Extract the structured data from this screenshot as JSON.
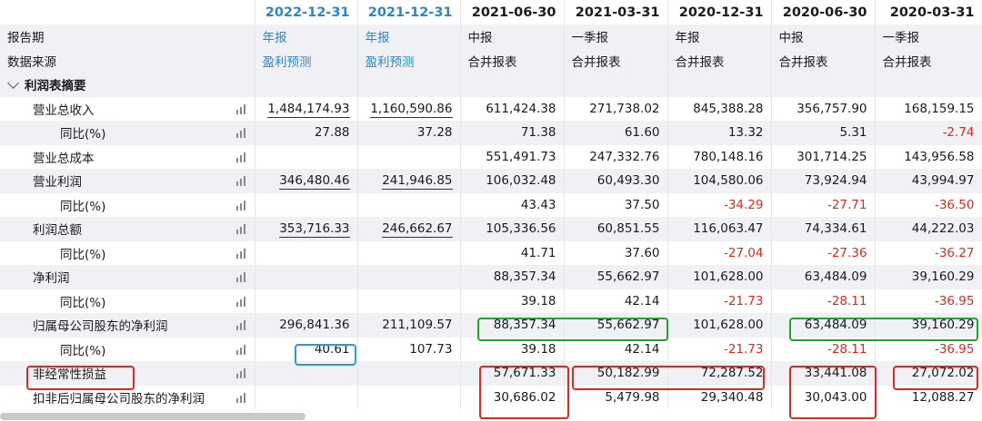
{
  "header": {
    "periods": [
      "2022-12-31",
      "2021-12-31",
      "2021-06-30",
      "2021-03-31",
      "2020-12-31",
      "2020-06-30",
      "2020-03-31"
    ],
    "report_label": "报告期",
    "report_types": [
      "年报",
      "年报",
      "中报",
      "一季报",
      "年报",
      "中报",
      "一季报"
    ],
    "source_label": "数据来源",
    "sources": [
      "盈利预测",
      "盈利预测",
      "合并报表",
      "合并报表",
      "合并报表",
      "合并报表",
      "合并报表"
    ]
  },
  "section": {
    "title": "利润表摘要"
  },
  "rows": [
    {
      "label": "营业总收入",
      "indent": 1,
      "values": [
        "1,484,174.93",
        "1,160,590.86",
        "611,424.38",
        "271,738.02",
        "845,388.28",
        "356,757.90",
        "168,159.15"
      ]
    },
    {
      "label": "同比(%)",
      "indent": 2,
      "values": [
        "27.88",
        "37.28",
        "71.38",
        "61.60",
        "13.32",
        "5.31",
        "-2.74"
      ]
    },
    {
      "label": "营业总成本",
      "indent": 1,
      "values": [
        "",
        "",
        "551,491.73",
        "247,332.76",
        "780,148.16",
        "301,714.25",
        "143,956.58"
      ]
    },
    {
      "label": "营业利润",
      "indent": 1,
      "values": [
        "346,480.46",
        "241,946.85",
        "106,032.48",
        "60,493.30",
        "104,580.06",
        "73,924.94",
        "43,994.97"
      ]
    },
    {
      "label": "同比(%)",
      "indent": 2,
      "values": [
        "",
        "",
        "43.43",
        "37.50",
        "-34.29",
        "-27.71",
        "-36.50"
      ]
    },
    {
      "label": "利润总额",
      "indent": 1,
      "values": [
        "353,716.33",
        "246,662.67",
        "105,336.56",
        "60,851.55",
        "116,063.47",
        "74,334.61",
        "44,222.03"
      ]
    },
    {
      "label": "同比(%)",
      "indent": 2,
      "values": [
        "",
        "",
        "41.71",
        "37.60",
        "-27.04",
        "-27.36",
        "-36.27"
      ]
    },
    {
      "label": "净利润",
      "indent": 1,
      "values": [
        "",
        "",
        "88,357.34",
        "55,662.97",
        "101,628.00",
        "63,484.09",
        "39,160.29"
      ]
    },
    {
      "label": "同比(%)",
      "indent": 2,
      "values": [
        "",
        "",
        "39.18",
        "42.14",
        "-21.73",
        "-28.11",
        "-36.95"
      ]
    },
    {
      "label": "归属母公司股东的净利润",
      "indent": 1,
      "values": [
        "296,841.36",
        "211,109.57",
        "88,357.34",
        "55,662.97",
        "101,628.00",
        "63,484.09",
        "39,160.29"
      ]
    },
    {
      "label": "同比(%)",
      "indent": 2,
      "values": [
        "40.61",
        "107.73",
        "39.18",
        "42.14",
        "-21.73",
        "-28.11",
        "-36.95"
      ]
    },
    {
      "label": "非经常性损益",
      "indent": 1,
      "values": [
        "",
        "",
        "57,671.33",
        "50,182.99",
        "72,287.52",
        "33,441.08",
        "27,072.02"
      ]
    },
    {
      "label": "扣非后归属母公司股东的净利润",
      "indent": 1,
      "values": [
        "",
        "",
        "30,686.02",
        "5,479.98",
        "29,340.48",
        "30,043.00",
        "12,088.27"
      ]
    }
  ],
  "colors": {
    "forecast": "#2e86c8",
    "negative": "#e0281e",
    "highlight_red": "#e0281e",
    "highlight_green": "#1fa52a",
    "highlight_blue": "#2a98e8"
  }
}
